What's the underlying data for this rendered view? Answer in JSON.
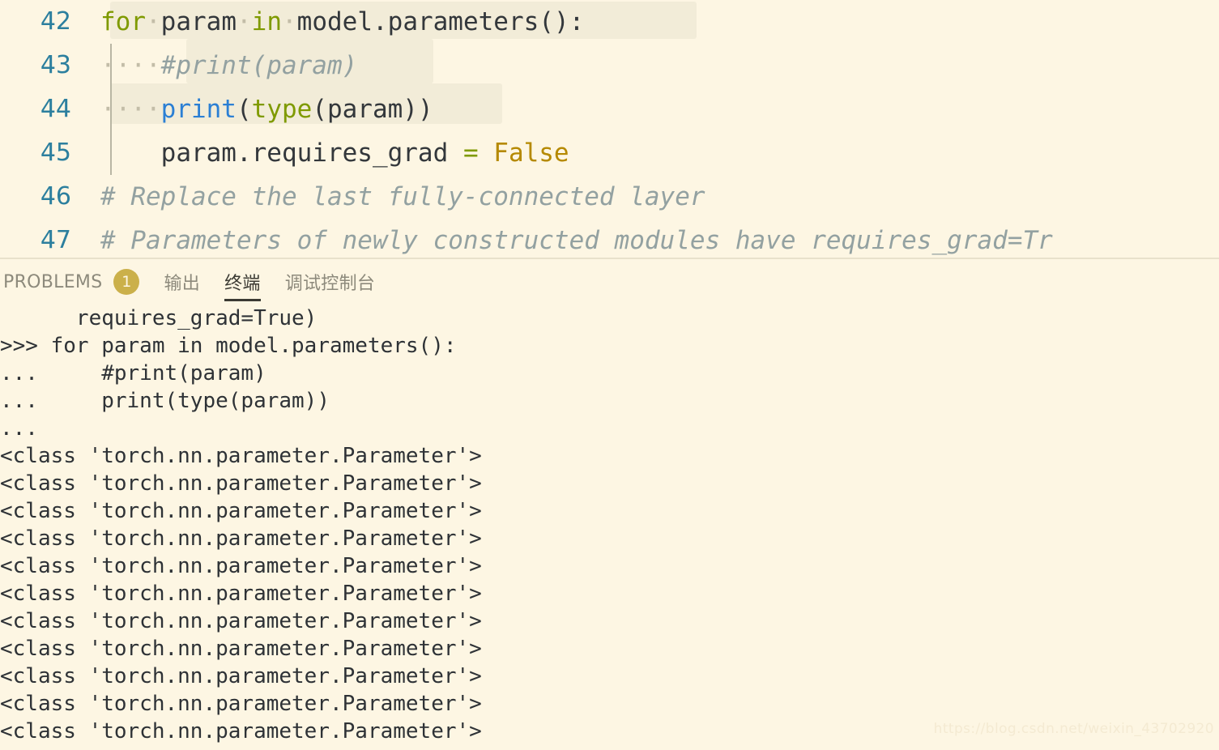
{
  "theme": {
    "background": "#fdf6e3",
    "keyword_color": "#7f9a00",
    "function_color": "#2b7fd4",
    "comment_color": "#93a1a1",
    "constant_color": "#b58900",
    "linenumber_color": "#2c7f9e",
    "badge_color": "#cbb04a",
    "selection_color": "#f2ecd8"
  },
  "editor": {
    "lines": [
      {
        "number": "42",
        "indent_guide": false,
        "tokens": [
          {
            "text": "for",
            "cls": "kw"
          },
          {
            "text": "·",
            "cls": "ws"
          },
          {
            "text": "param",
            "cls": "plain"
          },
          {
            "text": "·",
            "cls": "ws"
          },
          {
            "text": "in",
            "cls": "kw"
          },
          {
            "text": "·",
            "cls": "ws"
          },
          {
            "text": "model.parameters():",
            "cls": "plain"
          }
        ]
      },
      {
        "number": "43",
        "indent_guide": true,
        "tokens": [
          {
            "text": "····",
            "cls": "ws"
          },
          {
            "text": "#print(param)",
            "cls": "comment"
          }
        ]
      },
      {
        "number": "44",
        "indent_guide": true,
        "tokens": [
          {
            "text": "····",
            "cls": "ws"
          },
          {
            "text": "print",
            "cls": "fn-blue"
          },
          {
            "text": "(",
            "cls": "plain"
          },
          {
            "text": "type",
            "cls": "kw"
          },
          {
            "text": "(param))",
            "cls": "plain"
          }
        ]
      },
      {
        "number": "45",
        "indent_guide": true,
        "tokens": [
          {
            "text": "    param.requires_grad ",
            "cls": "plain"
          },
          {
            "text": "=",
            "cls": "op"
          },
          {
            "text": " ",
            "cls": "plain"
          },
          {
            "text": "False",
            "cls": "const"
          }
        ]
      },
      {
        "number": "46",
        "indent_guide": false,
        "tokens": [
          {
            "text": "# Replace the last fully-connected layer",
            "cls": "comment"
          }
        ]
      },
      {
        "number": "47",
        "indent_guide": false,
        "tokens": [
          {
            "text": "# Parameters of newly constructed modules have requires_grad=Tr",
            "cls": "comment"
          }
        ]
      }
    ]
  },
  "panel": {
    "tabs": [
      {
        "label": "PROBLEMS",
        "active": false,
        "badge": "1"
      },
      {
        "label": "输出",
        "active": false,
        "badge": null
      },
      {
        "label": "终端",
        "active": true,
        "badge": null
      },
      {
        "label": "调试控制台",
        "active": false,
        "badge": null
      }
    ],
    "terminal_lines": [
      "      requires_grad=True)",
      ">>> for param in model.parameters():",
      "...     #print(param)",
      "...     print(type(param))",
      "... ",
      "<class 'torch.nn.parameter.Parameter'>",
      "<class 'torch.nn.parameter.Parameter'>",
      "<class 'torch.nn.parameter.Parameter'>",
      "<class 'torch.nn.parameter.Parameter'>",
      "<class 'torch.nn.parameter.Parameter'>",
      "<class 'torch.nn.parameter.Parameter'>",
      "<class 'torch.nn.parameter.Parameter'>",
      "<class 'torch.nn.parameter.Parameter'>",
      "<class 'torch.nn.parameter.Parameter'>",
      "<class 'torch.nn.parameter.Parameter'>",
      "<class 'torch.nn.parameter.Parameter'>"
    ]
  },
  "watermark": {
    "text": "https://blog.csdn.net/weixin_43702920"
  }
}
